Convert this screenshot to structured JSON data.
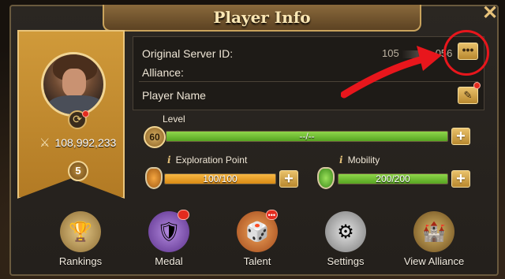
{
  "window": {
    "title": "Player Info",
    "close_icon": "close-icon"
  },
  "profile": {
    "power": "108,992,233",
    "rank_level": "5"
  },
  "info": {
    "server_label": "Original Server ID:",
    "server_value": "105",
    "server_value_tail": "056",
    "alliance_label": "Alliance:",
    "alliance_value": "",
    "player_name_label": "Player Name",
    "more_label": "•••",
    "edit_label": "✎"
  },
  "stats": {
    "level": {
      "label": "Level",
      "value": "60",
      "bar_text": "--/--",
      "fill": 1.0
    },
    "exploration": {
      "label": "Exploration Point",
      "bar_text": "100/100",
      "fill": 1.0
    },
    "mobility": {
      "label": "Mobility",
      "bar_text": "200/200",
      "fill": 1.0
    },
    "info_glyph": "i",
    "plus_label": "+"
  },
  "nav": [
    {
      "label": "Rankings",
      "icon": "podium-icon"
    },
    {
      "label": "Medal",
      "icon": "medal-icon",
      "badge": ""
    },
    {
      "label": "Talent",
      "icon": "talent-icon",
      "badge": "•••"
    },
    {
      "label": "Settings",
      "icon": "gear-icon"
    },
    {
      "label": "View Alliance",
      "icon": "alliance-icon"
    }
  ],
  "colors": {
    "accent_gold": "#d09a3a",
    "bar_green": "#6fbe2e",
    "bar_orange": "#f0a22a",
    "highlight_red": "#e8161c"
  }
}
